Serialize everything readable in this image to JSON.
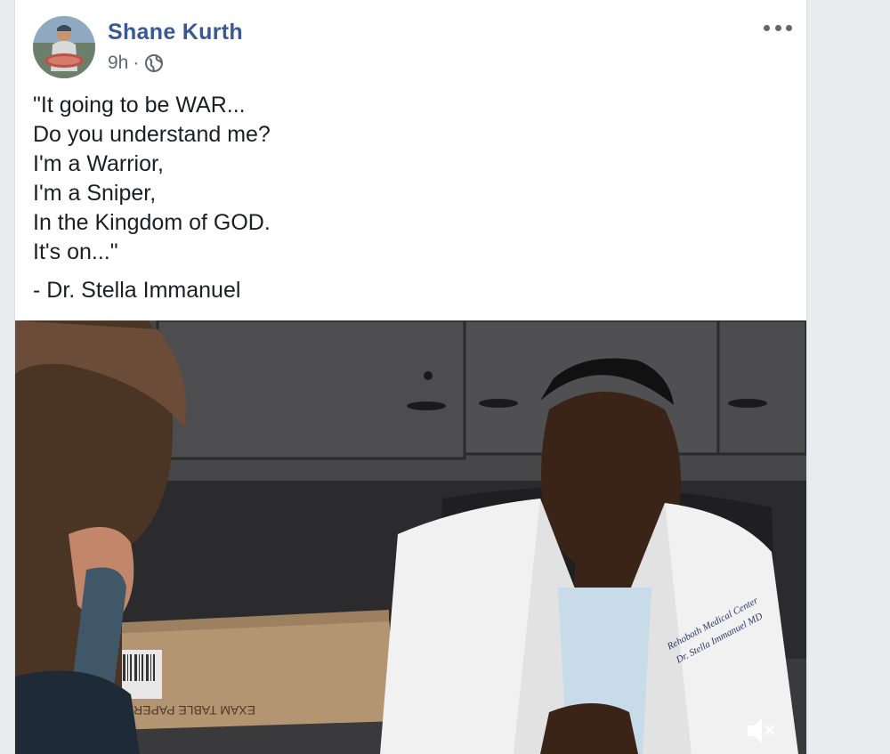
{
  "post": {
    "author": "Shane Kurth",
    "timestamp": "9h",
    "separator": "·",
    "privacy_icon": "globe-icon",
    "menu_icon": "more-options-icon",
    "text_lines": [
      "\"It going to be WAR...",
      "Do you understand me?",
      "I'm a Warrior,",
      "I'm a Sniper,",
      "In the Kingdom of GOD.",
      "It's on...\""
    ],
    "attribution": "- Dr. Stella Immanuel"
  },
  "video": {
    "coat_embroidery_line1": "Rehoboth Medical Center",
    "coat_embroidery_line2": "Dr. Stella Immanuel MD",
    "box_text": "EXAM TABLE PAPER",
    "mute_icon": "muted-speaker-icon"
  },
  "colors": {
    "author_link": "#385898",
    "meta_text": "#606770",
    "body_text": "#1c1e21",
    "page_background": "#e9ebee"
  }
}
